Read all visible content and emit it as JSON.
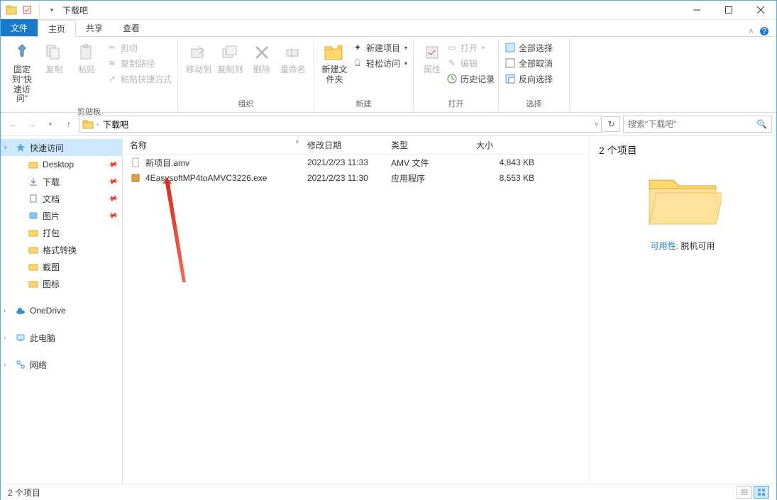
{
  "window": {
    "title": "下载吧"
  },
  "tabs": {
    "file": "文件",
    "home": "主页",
    "share": "共享",
    "view": "查看"
  },
  "ribbon": {
    "clipboard": {
      "pin": "固定到\"快速访问\"",
      "copy": "复制",
      "paste": "粘贴",
      "cut": "剪切",
      "copypath": "复制路径",
      "pasteshortcut": "粘贴快捷方式",
      "label": "剪贴板"
    },
    "organize": {
      "moveto": "移动到",
      "copyto": "复制到",
      "delete": "删除",
      "rename": "重命名",
      "label": "组织"
    },
    "new": {
      "newfolder": "新建文件夹",
      "newitem": "新建项目",
      "easyaccess": "轻松访问",
      "label": "新建"
    },
    "open": {
      "properties": "属性",
      "open": "打开",
      "edit": "编辑",
      "history": "历史记录",
      "label": "打开"
    },
    "select": {
      "selectall": "全部选择",
      "selectnone": "全部取消",
      "invert": "反向选择",
      "label": "选择"
    }
  },
  "address": {
    "segments": [
      "下载吧"
    ],
    "search_placeholder": "搜索\"下载吧\""
  },
  "nav": {
    "quick": "快速访问",
    "desktop": "Desktop",
    "downloads": "下载",
    "documents": "文档",
    "pictures": "图片",
    "pack": "打包",
    "convert": "格式转换",
    "screenshot": "截图",
    "icons": "图标",
    "onedrive": "OneDrive",
    "thispc": "此电脑",
    "network": "网络"
  },
  "columns": {
    "name": "名称",
    "date": "修改日期",
    "type": "类型",
    "size": "大小"
  },
  "files": [
    {
      "name": "新项目.amv",
      "date": "2021/2/23 11:33",
      "type": "AMV 文件",
      "size": "4,843 KB",
      "icon": "file"
    },
    {
      "name": "4EasysoftMP4toAMVC3226.exe",
      "date": "2021/2/23 11:30",
      "type": "应用程序",
      "size": "8,553 KB",
      "icon": "exe"
    }
  ],
  "details": {
    "count": "2 个项目",
    "avail_key": "可用性:",
    "avail_val": "脱机可用"
  },
  "status": {
    "text": "2 个项目"
  }
}
